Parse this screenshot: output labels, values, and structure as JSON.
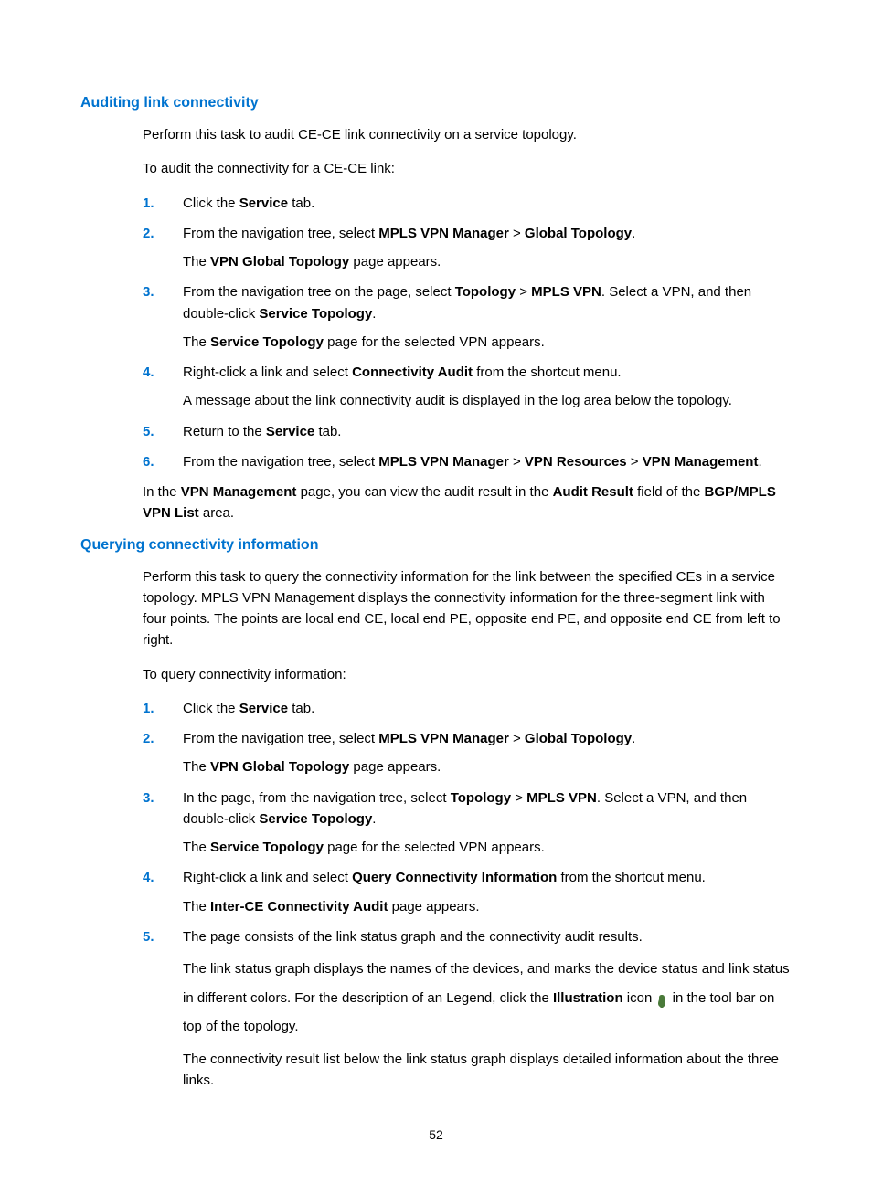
{
  "section1": {
    "heading": "Auditing link connectivity",
    "intro1": "Perform this task to audit CE-CE link connectivity on a service topology.",
    "intro2": "To audit the connectivity for a CE-CE link:",
    "steps": {
      "s1_a": "Click the ",
      "s1_b": "Service",
      "s1_c": " tab.",
      "s2_a": "From the navigation tree, select ",
      "s2_b": "MPLS VPN Manager",
      "s2_gt": " > ",
      "s2_d": "Global Topology",
      "s2_e": ".",
      "s2_sub_a": "The ",
      "s2_sub_b": "VPN Global Topology",
      "s2_sub_c": " page appears.",
      "s3_a": "From the navigation tree on the page, select ",
      "s3_b": "Topology",
      "s3_d": "MPLS VPN",
      "s3_e": ". Select a VPN, and then double-click ",
      "s3_f": "Service Topology",
      "s3_g": ".",
      "s3_sub_a": "The ",
      "s3_sub_b": "Service Topology",
      "s3_sub_c": " page for the selected VPN appears.",
      "s4_a": "Right-click a link and select ",
      "s4_b": "Connectivity Audit",
      "s4_c": " from the shortcut menu.",
      "s4_sub": "A message about the link connectivity audit is displayed in the log area below the topology.",
      "s5_a": "Return to the ",
      "s5_b": "Service",
      "s5_c": " tab.",
      "s6_a": "From the navigation tree, select ",
      "s6_b": "MPLS VPN Manager",
      "s6_d": "VPN Resources",
      "s6_f": "VPN Management",
      "s6_g": "."
    },
    "outro_a": "In the ",
    "outro_b": "VPN Management",
    "outro_c": " page, you can view the audit result in the ",
    "outro_d": "Audit Result",
    "outro_e": " field of the ",
    "outro_f": "BGP/MPLS VPN List",
    "outro_g": " area."
  },
  "section2": {
    "heading": "Querying connectivity information",
    "intro1": "Perform this task to query the connectivity information for the link between the specified CEs in a service topology. MPLS VPN Management displays the connectivity information for the three-segment link with four points. The points are local end CE, local end PE, opposite end PE, and opposite end CE from left to right.",
    "intro2": "To query connectivity information:",
    "steps": {
      "s1_a": "Click the ",
      "s1_b": "Service",
      "s1_c": " tab.",
      "s2_a": "From the navigation tree, select ",
      "s2_b": "MPLS VPN Manager",
      "s2_gt": " > ",
      "s2_d": "Global Topology",
      "s2_e": ".",
      "s2_sub_a": "The ",
      "s2_sub_b": "VPN Global Topology",
      "s2_sub_c": " page appears.",
      "s3_a": "In the page, from the navigation tree, select ",
      "s3_b": "Topology",
      "s3_d": "MPLS VPN",
      "s3_e": ". Select a VPN, and then double-click ",
      "s3_f": "Service Topology",
      "s3_g": ".",
      "s3_sub_a": "The ",
      "s3_sub_b": "Service Topology",
      "s3_sub_c": " page for the selected VPN appears.",
      "s4_a": "Right-click a link and select ",
      "s4_b": "Query Connectivity Information",
      "s4_c": " from the shortcut menu.",
      "s4_sub_a": "The ",
      "s4_sub_b": "Inter-CE Connectivity Audit",
      "s4_sub_c": " page appears.",
      "s5_a": "The page consists of the link status graph and the connectivity audit results.",
      "s5_sub1_a": "The link status graph displays the names of the devices, and marks the device status and link status in different colors. For the description of an Legend, click the ",
      "s5_sub1_b": "Illustration",
      "s5_sub1_c": " icon ",
      "s5_sub1_d": " in the tool bar on top of the topology.",
      "s5_sub2": "The connectivity result list below the link status graph displays detailed information about the three links."
    }
  },
  "nums": {
    "n1": "1.",
    "n2": "2.",
    "n3": "3.",
    "n4": "4.",
    "n5": "5.",
    "n6": "6."
  },
  "page_number": "52"
}
